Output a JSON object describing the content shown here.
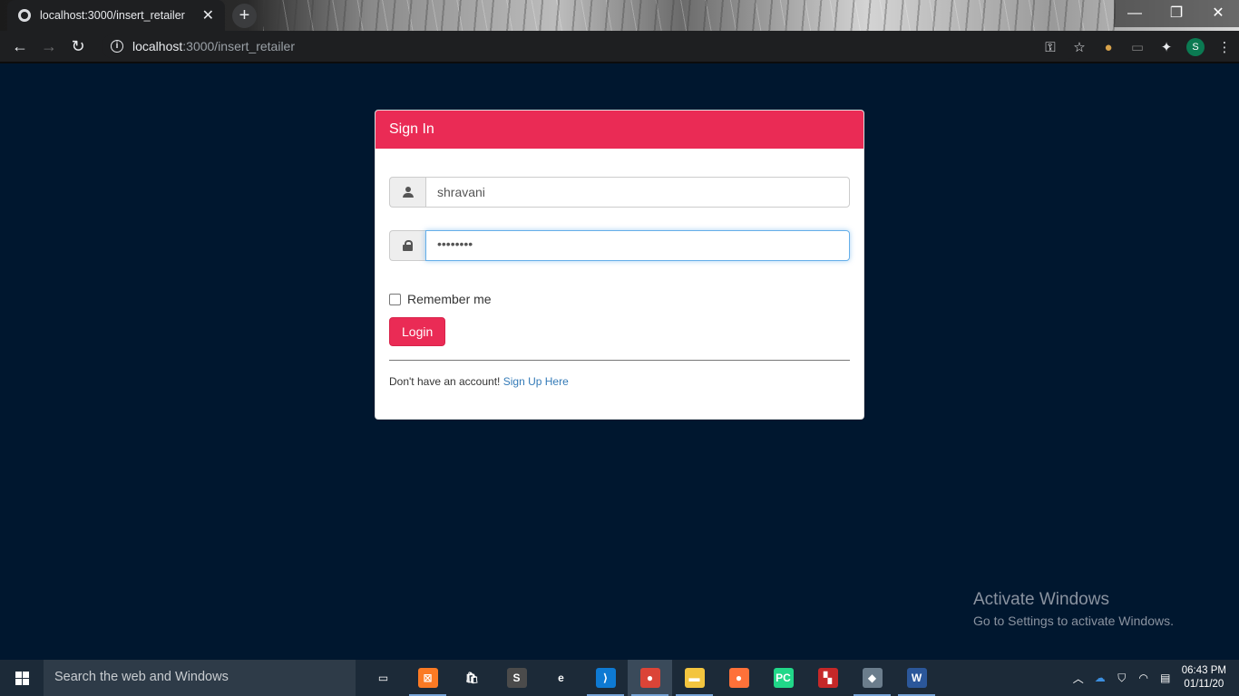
{
  "browser": {
    "tab_title": "localhost:3000/insert_retailer",
    "tab_close": "✕",
    "new_tab": "+",
    "url_host": "localhost",
    "url_path": ":3000/insert_retailer",
    "profile_initial": "S",
    "window_controls": {
      "minimize": "—",
      "maximize": "❐",
      "close": "✕"
    }
  },
  "signin": {
    "header": "Sign In",
    "username_value": "shravani",
    "password_value": "••••••••",
    "remember_label": "Remember me",
    "login_button": "Login",
    "no_account_text": "Don't have an account!",
    "signup_link": "Sign Up Here"
  },
  "watermark": {
    "line1": "Activate Windows",
    "line2": "Go to Settings to activate Windows."
  },
  "taskbar": {
    "search_placeholder": "Search the web and Windows",
    "time": "06:43 PM",
    "date": "01/11/20",
    "apps": [
      {
        "name": "task-view",
        "label": "▭",
        "color": "transparent",
        "open": false
      },
      {
        "name": "xampp",
        "label": "⊠",
        "color": "#fb7a24",
        "open": true
      },
      {
        "name": "store",
        "label": "🛍",
        "color": "transparent",
        "open": false
      },
      {
        "name": "sublime",
        "label": "S",
        "color": "#4b4b4b",
        "open": false
      },
      {
        "name": "edge",
        "label": "e",
        "color": "transparent",
        "open": false
      },
      {
        "name": "vscode",
        "label": "⟩",
        "color": "#0e7ad3",
        "open": true
      },
      {
        "name": "chrome",
        "label": "●",
        "color": "#db4437",
        "open": true
      },
      {
        "name": "file-explorer",
        "label": "▬",
        "color": "#f3c53f",
        "open": true
      },
      {
        "name": "firefox",
        "label": "●",
        "color": "#ff7139",
        "open": false
      },
      {
        "name": "pycharm",
        "label": "PC",
        "color": "#21d789",
        "open": false
      },
      {
        "name": "app-colored",
        "label": "▚",
        "color": "#c62828",
        "open": false
      },
      {
        "name": "git",
        "label": "◆",
        "color": "#6b7d8c",
        "open": true
      },
      {
        "name": "word",
        "label": "W",
        "color": "#2b579a",
        "open": true
      }
    ]
  }
}
